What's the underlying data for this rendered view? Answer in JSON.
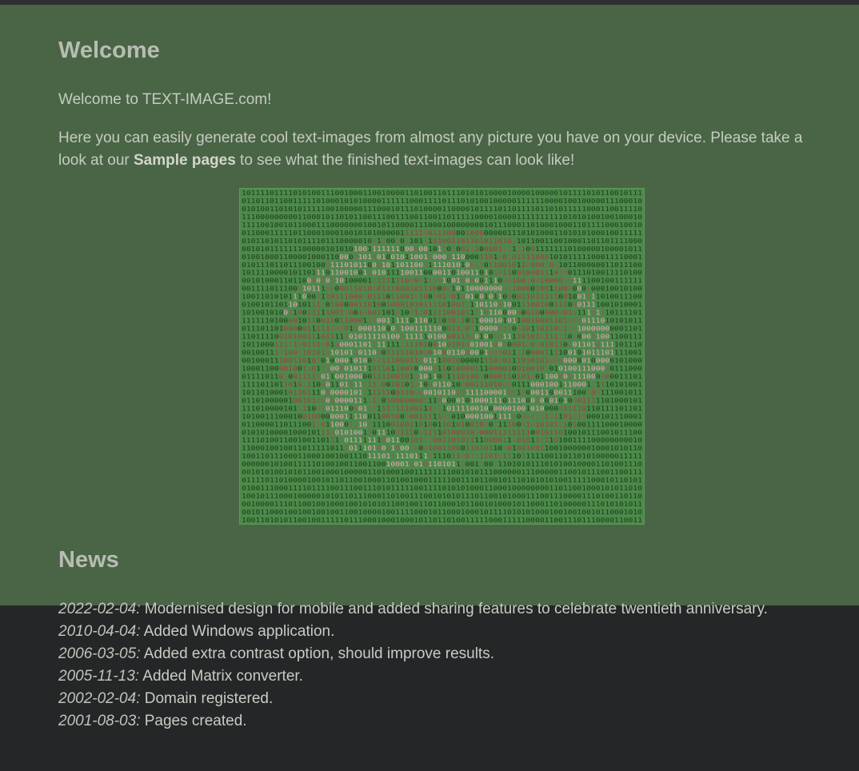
{
  "welcome": {
    "title": "Welcome",
    "intro": "Welcome to TEXT-IMAGE.com!",
    "para_before": "Here you can easily generate cool text-images from almost any picture you have on your device. Please take a look at our ",
    "sample_link": "Sample pages",
    "para_after": " to see what the finished text-images can look like!"
  },
  "colors": {
    "page_bg": "#252628",
    "welcome_band": "#4a6546",
    "image_bg": "#4c8a4a",
    "digit_green": "#1d3b1d",
    "digit_red": "#a3384a",
    "digit_pink": "#e8a6c0"
  },
  "news": {
    "title": "News",
    "items": [
      {
        "date": "2022-02-04:",
        "text": " Modernised design for mobile and added sharing features to celebrate twentieth anniversary."
      },
      {
        "date": "2010-04-04:",
        "text": " Added Windows application."
      },
      {
        "date": "2006-03-05:",
        "text": " Added extra contrast option, should improve results."
      },
      {
        "date": "2005-11-13:",
        "text": " Added Matrix converter."
      },
      {
        "date": "2002-02-04:",
        "text": " Domain registered."
      },
      {
        "date": "2001-08-03:",
        "text": " Pages created."
      }
    ]
  }
}
